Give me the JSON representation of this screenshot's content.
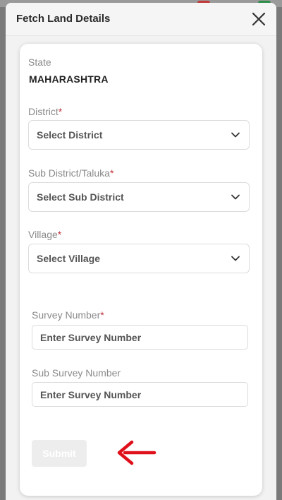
{
  "modal": {
    "title": "Fetch Land Details"
  },
  "form": {
    "state": {
      "label": "State",
      "value": "MAHARASHTRA"
    },
    "district": {
      "label": "District",
      "required_mark": "*",
      "placeholder": "Select District"
    },
    "sub_district": {
      "label": "Sub District/Taluka",
      "required_mark": "*",
      "placeholder": "Select Sub District"
    },
    "village": {
      "label": "Village",
      "required_mark": "*",
      "placeholder": "Select Village"
    },
    "survey_number": {
      "label": "Survey Number",
      "required_mark": "*",
      "placeholder": "Enter Survey Number"
    },
    "sub_survey_number": {
      "label": "Sub Survey Number",
      "placeholder": "Enter Survey Number"
    },
    "submit_label": "Submit"
  },
  "colors": {
    "required": "#c0313b",
    "annotation_arrow": "#e0101b"
  },
  "icons": {
    "close": "close-icon",
    "dropdown": "chevron-down-icon",
    "annotation": "red-arrow-icon"
  }
}
